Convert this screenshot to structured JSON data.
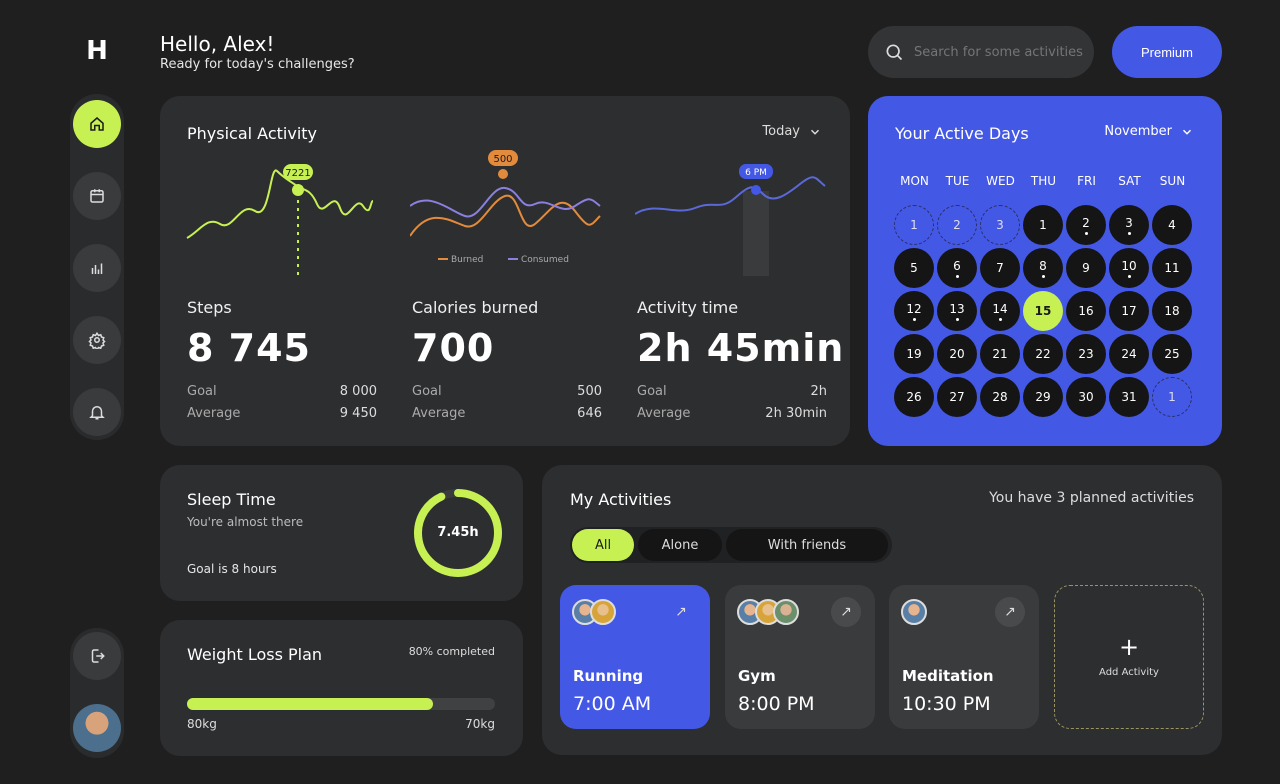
{
  "app": {
    "logo_text": "H"
  },
  "header": {
    "greeting": "Hello, Alex!",
    "subtitle": "Ready for today's challenges?",
    "search_placeholder": "Search for some activities",
    "premium_label": "Premium"
  },
  "sidebar": {
    "items": [
      {
        "icon": "home-icon",
        "active": true
      },
      {
        "icon": "calendar-icon",
        "active": false
      },
      {
        "icon": "stats-icon",
        "active": false
      },
      {
        "icon": "gear-icon",
        "active": false
      },
      {
        "icon": "bell-icon",
        "active": false
      }
    ],
    "logout_icon": "logout-icon"
  },
  "physical_activity": {
    "title": "Physical Activity",
    "period": "Today",
    "steps": {
      "label": "Steps",
      "value": "8 745",
      "goal_label": "Goal",
      "goal": "8 000",
      "avg_label": "Average",
      "avg": "9 450",
      "marker": "7221"
    },
    "calories": {
      "label": "Calories burned",
      "value": "700",
      "goal_label": "Goal",
      "goal": "500",
      "avg_label": "Average",
      "avg": "646",
      "marker": "500",
      "legend_burned": "Burned",
      "legend_consumed": "Consumed"
    },
    "time": {
      "label": "Activity time",
      "value": "2h 45min",
      "goal_label": "Goal",
      "goal": "2h",
      "avg_label": "Average",
      "avg": "2h 30min",
      "marker": "6 PM"
    }
  },
  "calendar": {
    "title": "Your Active Days",
    "month": "November",
    "weekdays": [
      "MON",
      "TUE",
      "WED",
      "THU",
      "FRI",
      "SAT",
      "SUN"
    ],
    "leading_days": [
      "1",
      "2",
      "3"
    ],
    "days_in_month": 31,
    "today": 15,
    "marked_days": [
      2,
      3,
      6,
      8,
      10,
      12,
      13,
      14
    ],
    "trailing_days": [
      "1"
    ]
  },
  "sleep": {
    "title": "Sleep Time",
    "subtitle": "You're almost there",
    "goal_text": "Goal is 8 hours",
    "value": "7.45h",
    "progress": 0.93
  },
  "weight": {
    "title": "Weight Loss Plan",
    "completed": "80% completed",
    "progress": 0.8,
    "start": "80kg",
    "target": "70kg"
  },
  "activities": {
    "title": "My Activities",
    "planned": "You have 3 planned activities",
    "filters": [
      "All",
      "Alone",
      "With friends"
    ],
    "items": [
      {
        "name": "Running",
        "time": "7:00 AM"
      },
      {
        "name": "Gym",
        "time": "8:00 PM"
      },
      {
        "name": "Meditation",
        "time": "10:30 PM"
      }
    ],
    "add_label": "Add Activity",
    "add_symbol": "+"
  },
  "colors": {
    "accent": "#c7f153",
    "brand": "#4458e6",
    "card": "#2d2e30",
    "burned": "#e38b3c",
    "consumed": "#8b7fe0"
  }
}
